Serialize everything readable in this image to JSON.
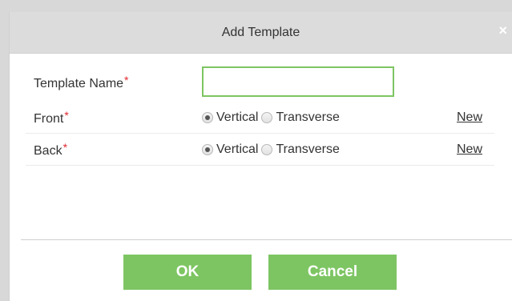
{
  "dialog": {
    "title": "Add Template",
    "close_icon": "close-icon",
    "close_glyph": "×"
  },
  "form": {
    "template_name": {
      "label": "Template Name",
      "required_mark": "*",
      "value": ""
    },
    "front": {
      "label": "Front",
      "required_mark": "*",
      "options": [
        "Vertical",
        "Transverse"
      ],
      "selected": "Vertical",
      "new_link": "New"
    },
    "back": {
      "label": "Back",
      "required_mark": "*",
      "options": [
        "Vertical",
        "Transverse"
      ],
      "selected": "Vertical",
      "new_link": "New"
    }
  },
  "buttons": {
    "ok": "OK",
    "cancel": "Cancel"
  },
  "colors": {
    "accent": "#7dc562",
    "required": "#e0282e",
    "titlebar": "#dcdcdc"
  }
}
